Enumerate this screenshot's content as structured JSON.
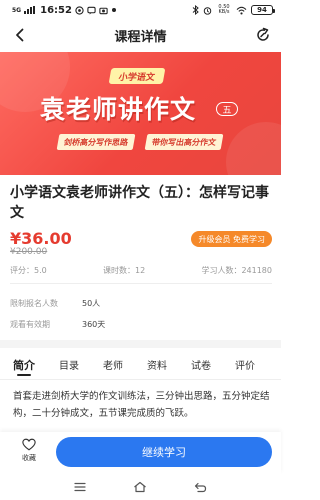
{
  "status_bar": {
    "signal_label": "5G",
    "time": "16:52",
    "speed": "0.50 KB/s",
    "battery": "94"
  },
  "header": {
    "title": "课程详情"
  },
  "banner": {
    "tag": "小学语文",
    "title": "袁老师讲作文",
    "number": "五",
    "pill_1": "剑桥高分写作思路",
    "pill_2": "带你写出高分作文"
  },
  "course": {
    "title": "小学语文袁老师讲作文（五）：怎样写记事文",
    "price": "¥36.00",
    "original_price": "¥200.00",
    "vip_button_label": "升级会员 免费学习",
    "rating": "评分：5.0",
    "lessons": "课时数：12",
    "learners": "学习人数：241180",
    "enroll_limit_label": "限制报名人数",
    "enroll_limit_value": "50人",
    "validity_label": "观看有效期",
    "validity_value": "360天"
  },
  "tabs": [
    {
      "label": "简介",
      "active": true
    },
    {
      "label": "目录",
      "active": false
    },
    {
      "label": "老师",
      "active": false
    },
    {
      "label": "资料",
      "active": false
    },
    {
      "label": "试卷",
      "active": false
    },
    {
      "label": "评价",
      "active": false
    }
  ],
  "intro": {
    "text": "首套走进剑桥大学的作文训练法，三分钟出思路，五分钟定结构，二十分钟成文，五节课完成质的飞跃。"
  },
  "bottom_bar": {
    "favorite_label": "收藏",
    "continue_label": "继续学习"
  },
  "colors": {
    "brand_blue": "#2b78f0",
    "price_red": "#e53b2f",
    "vip_orange": "#f5892a",
    "banner_red": "#f0463f"
  }
}
